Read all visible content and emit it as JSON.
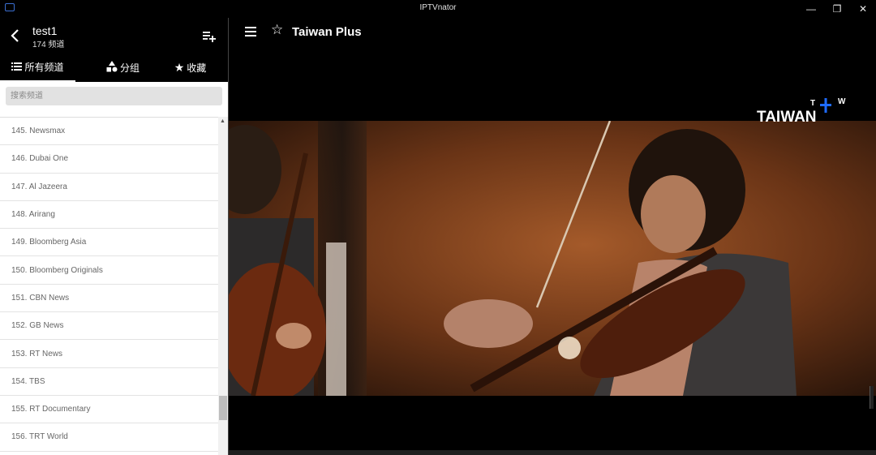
{
  "window": {
    "title": "IPTVnator",
    "minimize_glyph": "—",
    "maximize_glyph": "❐",
    "close_glyph": "✕"
  },
  "sidebar": {
    "playlist_name": "test1",
    "channel_count": "174 频道",
    "tabs": [
      {
        "icon": "list-icon",
        "label": "所有频道",
        "active": true
      },
      {
        "icon": "category-icon",
        "label": "分组",
        "active": false
      },
      {
        "icon": "star-icon",
        "label": "收藏",
        "active": false
      }
    ],
    "search": {
      "placeholder": "搜索频道",
      "value": ""
    },
    "channels": [
      "145. Newsmax",
      "146. Dubai One",
      "147. Al Jazeera",
      "148. Arirang",
      "149. Bloomberg Asia",
      "150. Bloomberg Originals",
      "151. CBN News",
      "152. GB News",
      "153. RT News",
      "154. TBS",
      "155. RT Documentary",
      "156. TRT World"
    ]
  },
  "player": {
    "channel_title": "Taiwan Plus",
    "logo_text": "TAIWAN",
    "logo_superscript_t": "T",
    "logo_superscript_w": "W"
  },
  "colors": {
    "accent_blue": "#1e6bff",
    "header_bg": "#000000",
    "list_text": "#666666"
  }
}
